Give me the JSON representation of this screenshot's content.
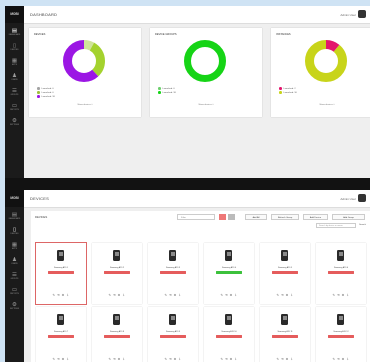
{
  "app": {
    "logo": "MOBI"
  },
  "dashboard": {
    "title": "DASHBOARD",
    "user": "Admin User",
    "sidebar": [
      {
        "icon": "server-icon",
        "label": "DASHBOARD"
      },
      {
        "icon": "tablet-icon",
        "label": "DEVICES"
      },
      {
        "icon": "grid-icon",
        "label": "APPS"
      },
      {
        "icon": "user-icon",
        "label": "USERS"
      },
      {
        "icon": "list-icon",
        "label": "GROUPS"
      },
      {
        "icon": "monitor-icon",
        "label": "REPORTS"
      },
      {
        "icon": "gear-icon",
        "label": "SETTINGS"
      }
    ],
    "cards": [
      {
        "title": "DEVICES",
        "legend": [
          {
            "label": "Launched: 0",
            "color": "#a3a3a3"
          },
          {
            "label": "Launched: 0",
            "color": "#9fbf3b"
          },
          {
            "label": "Launched: 18",
            "color": "#9b16e4"
          }
        ],
        "link": "Show devices »",
        "donut": {
          "outer": 21,
          "inner": 12,
          "segments": [
            {
              "fraction": 0.08,
              "color": "#cfe39a"
            },
            {
              "fraction": 0.3,
              "color": "#a4d22e"
            },
            {
              "fraction": 0.62,
              "color": "#9b16e4"
            }
          ]
        }
      },
      {
        "title": "DEVICE GROUPS",
        "legend": [
          {
            "label": "Launched: 0",
            "color": "#6ccf6c"
          },
          {
            "label": "Launched: 18",
            "color": "#16d416"
          }
        ],
        "link": "Show devices »",
        "donut": {
          "outer": 21,
          "inner": 14,
          "segments": [
            {
              "fraction": 1.0,
              "color": "#16d416"
            }
          ]
        }
      },
      {
        "title": "INSTANCES",
        "legend": [
          {
            "label": "Launched: 2",
            "color": "#e3166c"
          },
          {
            "label": "Launched: 16",
            "color": "#c8d41a"
          }
        ],
        "link": "Show devices »",
        "donut": {
          "outer": 21,
          "inner": 12,
          "segments": [
            {
              "fraction": 0.11,
              "color": "#e3166c"
            },
            {
              "fraction": 0.89,
              "color": "#c8d41a"
            }
          ]
        }
      }
    ]
  },
  "devices": {
    "title": "DEVICES",
    "user": "Admin User",
    "panel_title": "DEVICES",
    "filter_placeholder": "Filter",
    "toolbar_buttons": [
      "Add All",
      "Refresh Group",
      "Add Device",
      "Add Group"
    ],
    "search_placeholder": "Search by device or owner",
    "search_label": "Search",
    "colors": {
      "offline": "#e55c5c",
      "online": "#3cc13c"
    },
    "cards": [
      {
        "name": "Samsung A70 1",
        "status": "offline",
        "selected": true
      },
      {
        "name": "Samsung A70 2",
        "status": "offline"
      },
      {
        "name": "Samsung A70 3",
        "status": "offline"
      },
      {
        "name": "Samsung A70 4",
        "status": "online"
      },
      {
        "name": "Samsung A70 5",
        "status": "offline"
      },
      {
        "name": "Samsung A70 6",
        "status": "offline"
      },
      {
        "name": "Samsung A70 7",
        "status": "offline"
      },
      {
        "name": "Samsung A70 8",
        "status": "offline"
      },
      {
        "name": "Samsung A70 9",
        "status": "offline"
      },
      {
        "name": "Samsung A70 10",
        "status": "offline"
      },
      {
        "name": "Samsung A70 11",
        "status": "offline"
      },
      {
        "name": "Samsung A70 12",
        "status": "offline"
      }
    ],
    "status_text": "",
    "card_icons": "✎ ⟲ ⚙ ⇩"
  }
}
